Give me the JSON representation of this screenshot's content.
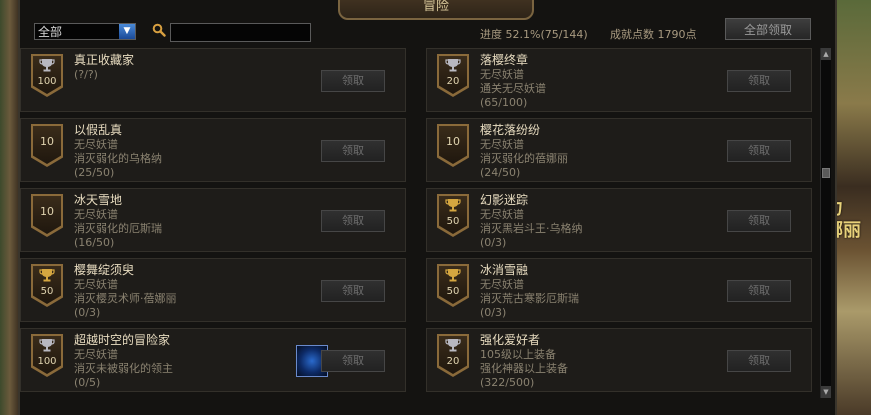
{
  "window": {
    "title": "冒险"
  },
  "filter": {
    "selected": "全部",
    "search_value": ""
  },
  "stats": {
    "progress": "进度 52.1%(75/144)",
    "points": "成就点数 1790点"
  },
  "claim_all_label": "全部领取",
  "claim_label": "领取",
  "achievements": [
    {
      "medal": "100",
      "medal_style": "top",
      "cup": "silver",
      "title": "真正收藏家",
      "lines": [
        "(?/?)"
      ]
    },
    {
      "medal": "20",
      "medal_style": "top",
      "cup": "silver",
      "title": "落樱终章",
      "lines": [
        "无尽妖谱",
        "通关无尽妖谱",
        "(65/100)"
      ]
    },
    {
      "medal": "10",
      "medal_style": "low",
      "cup": "none",
      "title": "以假乱真",
      "lines": [
        "无尽妖谱",
        "消灭弱化的乌格纳",
        "(25/50)"
      ]
    },
    {
      "medal": "10",
      "medal_style": "low",
      "cup": "none",
      "title": "樱花落纷纷",
      "lines": [
        "无尽妖谱",
        "消灭弱化的蓓娜丽",
        "(24/50)"
      ]
    },
    {
      "medal": "10",
      "medal_style": "low",
      "cup": "none",
      "title": "冰天雪地",
      "lines": [
        "无尽妖谱",
        "消灭弱化的厄斯瑞",
        "(16/50)"
      ]
    },
    {
      "medal": "50",
      "medal_style": "top",
      "cup": "gold",
      "title": "幻影迷踪",
      "lines": [
        "无尽妖谱",
        "消灭黑岩斗王·乌格纳",
        "(0/3)"
      ]
    },
    {
      "medal": "50",
      "medal_style": "top",
      "cup": "gold",
      "title": "樱舞绽须臾",
      "lines": [
        "无尽妖谱",
        "消灭樱灵术师·蓓娜丽",
        "(0/3)"
      ]
    },
    {
      "medal": "50",
      "medal_style": "top",
      "cup": "gold",
      "title": "冰消雪融",
      "lines": [
        "无尽妖谱",
        "消灭荒古寒影厄斯瑞",
        "(0/3)"
      ]
    },
    {
      "medal": "100",
      "medal_style": "top",
      "cup": "silver",
      "title": "超越时空的冒险家",
      "lines": [
        "无尽妖谱",
        "消灭未被弱化的领主",
        "(0/5)"
      ],
      "reward_icon": "blue-orb-icon"
    },
    {
      "medal": "20",
      "medal_style": "top",
      "cup": "silver",
      "title": "强化爱好者",
      "lines": [
        "105级以上装备",
        "强化神器以上装备",
        "(322/500)"
      ]
    }
  ],
  "colors": {
    "gold_cup": "#d4a640",
    "silver_cup": "#b8b8c0",
    "title_text": "#e8dcc0",
    "sub_text": "#8a8270"
  },
  "scene_text": "力\n娜丽"
}
